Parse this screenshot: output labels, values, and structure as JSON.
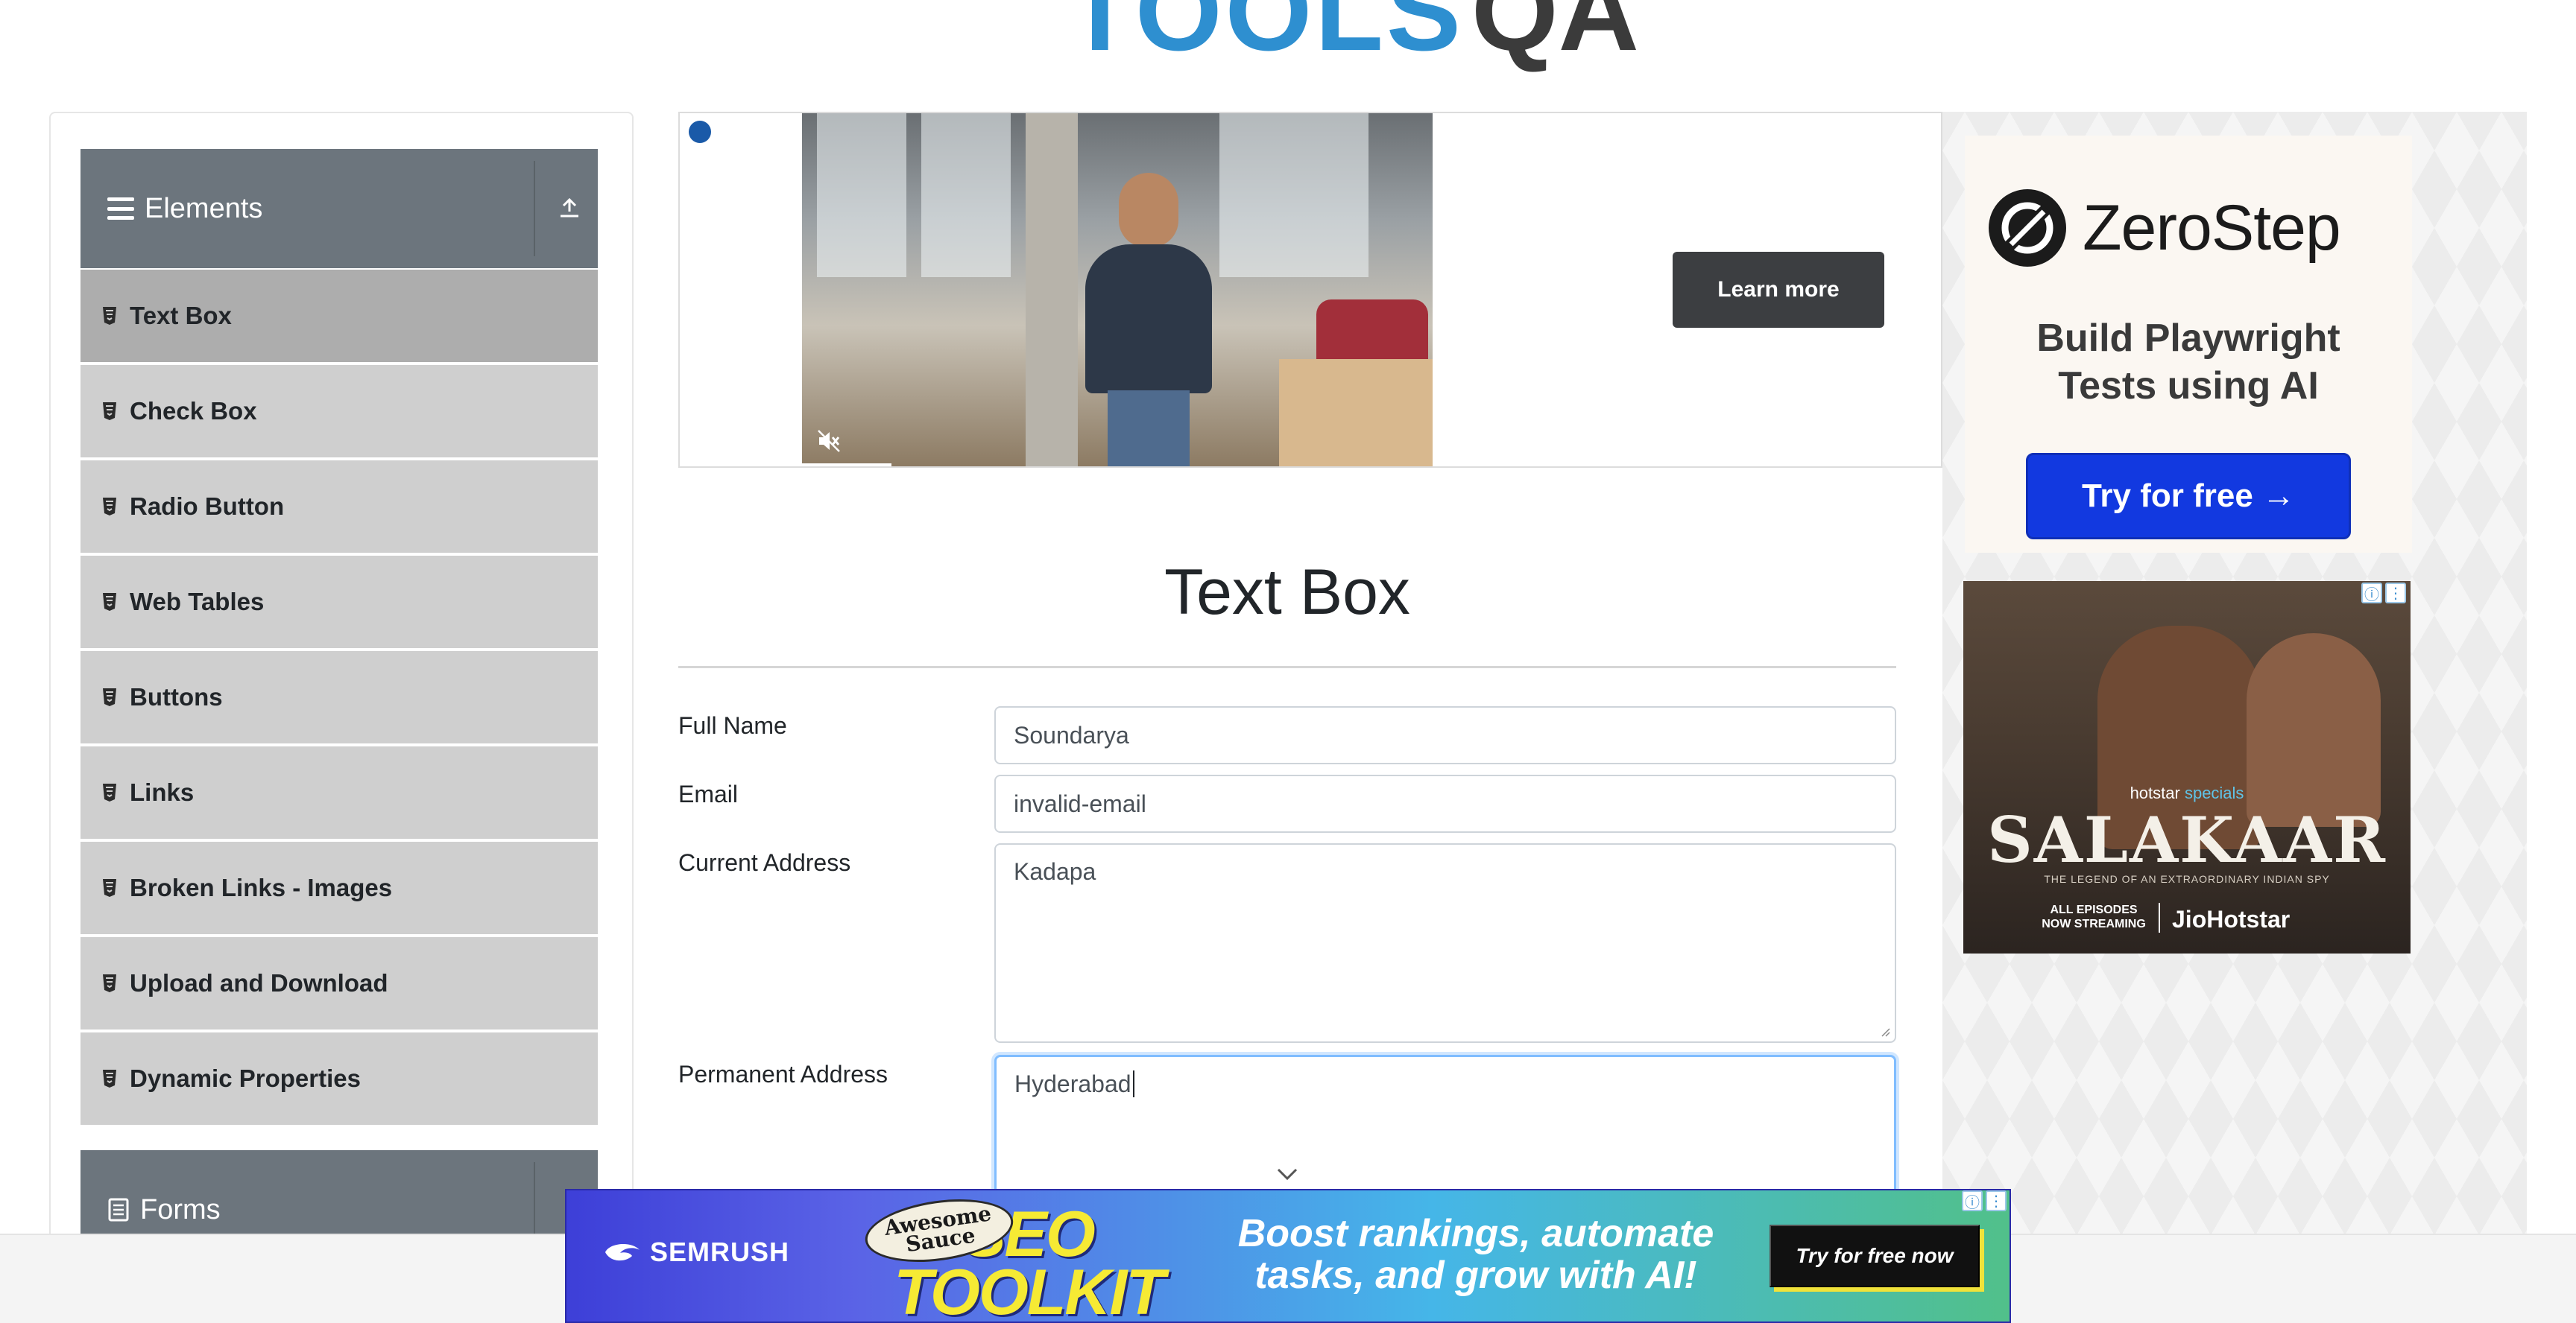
{
  "brand": {
    "logo_text": "TOOLS",
    "logo_qa": "QA"
  },
  "sidebar": {
    "group_title": "Elements",
    "items": [
      {
        "label": "Text Box",
        "active": true
      },
      {
        "label": "Check Box"
      },
      {
        "label": "Radio Button"
      },
      {
        "label": "Web Tables"
      },
      {
        "label": "Buttons"
      },
      {
        "label": "Links"
      },
      {
        "label": "Broken Links - Images"
      },
      {
        "label": "Upload and Download"
      },
      {
        "label": "Dynamic Properties"
      }
    ],
    "next_group_title": "Forms"
  },
  "video_ad": {
    "cta_label": "Learn more"
  },
  "main": {
    "title": "Text Box",
    "fields": {
      "full_name": {
        "label": "Full Name",
        "value": "Soundarya"
      },
      "email": {
        "label": "Email",
        "value": "invalid-email"
      },
      "current_address": {
        "label": "Current Address",
        "value": "Kadapa"
      },
      "permanent_address": {
        "label": "Permanent Address",
        "value": "Hyderabad"
      }
    }
  },
  "zerostep_ad": {
    "brand": "ZeroStep",
    "tagline_line1": "Build Playwright",
    "tagline_line2": "Tests using AI",
    "cta_label": "Try for free →"
  },
  "movie_ad": {
    "brand_prefix": "hotstar",
    "brand_suffix": "specials",
    "title": "SALAKAAR",
    "subtitle": "THE LEGEND OF AN EXTRAORDINARY INDIAN SPY",
    "streaming_line1": "ALL EPISODES",
    "streaming_line2": "NOW STREAMING",
    "platform": "JioHotstar"
  },
  "banner_ad": {
    "brand": "SEMRUSH",
    "badge_line1": "Awesome",
    "badge_line2": "Sauce",
    "product_line1": "SEO",
    "product_line2": "TOOLKIT",
    "headline_line1": "Boost rankings, automate",
    "headline_line2": "tasks, and grow with AI!",
    "cta_label": "Try for free now"
  },
  "colors": {
    "sidebar_header": "#6c757d",
    "menu_item": "#cfcfcf",
    "menu_item_active": "#adadad",
    "focus_border": "#80bdff",
    "zerostep_cta": "#1239e0"
  }
}
